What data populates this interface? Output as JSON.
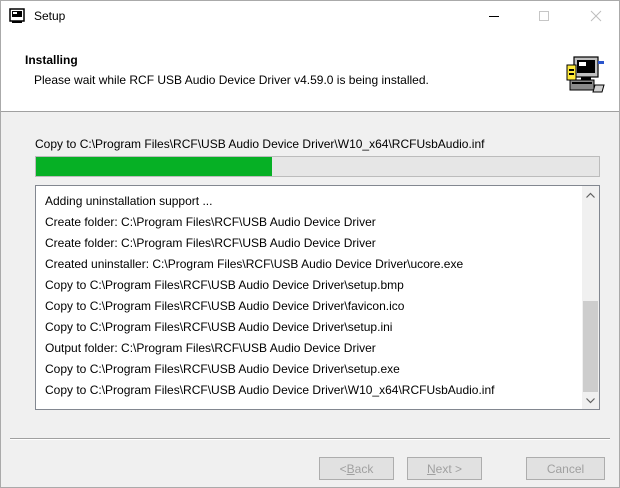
{
  "window": {
    "title": "Setup",
    "controls": {
      "minimize": "—",
      "maximize": "☐",
      "close": "✕"
    },
    "app_icon": "installer-icon"
  },
  "header": {
    "title": "Installing",
    "subtitle": "Please wait while RCF USB Audio Device Driver v4.59.0 is being installed.",
    "icon": "computer-install-icon"
  },
  "status": {
    "text": "Copy to C:\\Program Files\\RCF\\USB Audio Device Driver\\W10_x64\\RCFUsbAudio.inf",
    "progress": 0.42
  },
  "log": {
    "items": [
      "Adding uninstallation support ...",
      "Create folder: C:\\Program Files\\RCF\\USB Audio Device Driver",
      "Create folder: C:\\Program Files\\RCF\\USB Audio Device Driver",
      "Created uninstaller: C:\\Program Files\\RCF\\USB Audio Device Driver\\ucore.exe",
      "Copy to C:\\Program Files\\RCF\\USB Audio Device Driver\\setup.bmp",
      "Copy to C:\\Program Files\\RCF\\USB Audio Device Driver\\favicon.ico",
      "Copy to C:\\Program Files\\RCF\\USB Audio Device Driver\\setup.ini",
      "Output folder: C:\\Program Files\\RCF\\USB Audio Device Driver",
      "Copy to C:\\Program Files\\RCF\\USB Audio Device Driver\\setup.exe",
      "Copy to C:\\Program Files\\RCF\\USB Audio Device Driver\\W10_x64\\RCFUsbAudio.inf"
    ],
    "scroll": {
      "up": "▲",
      "down": "▼",
      "position": 1.0,
      "visible_fraction": 0.48
    }
  },
  "buttons": {
    "back": "< Back",
    "next": "Next >",
    "cancel": "Cancel"
  }
}
